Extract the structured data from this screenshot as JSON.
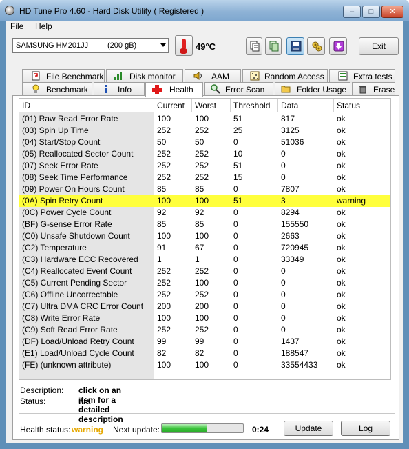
{
  "window": {
    "title": "HD Tune Pro 4.60 - Hard Disk Utility ( Registered )",
    "controls": {
      "minimize": "–",
      "maximize": "□",
      "close": "✕"
    }
  },
  "menu": {
    "file": {
      "accel": "F",
      "rest": "ile"
    },
    "help": {
      "accel": "H",
      "rest": "elp"
    }
  },
  "toolbar": {
    "drive_name": "SAMSUNG HM201JJ",
    "drive_size": "(200 gB)",
    "temperature": "49°C",
    "exit_label": "Exit",
    "icons": [
      "thermometer-icon",
      "copy-text-icon",
      "copy-screenshot-icon",
      "save-icon",
      "options-icon",
      "down-arrow-icon"
    ]
  },
  "tabs": {
    "row1": [
      "File Benchmark",
      "Disk monitor",
      "AAM",
      "Random Access",
      "Extra tests"
    ],
    "row2": [
      "Benchmark",
      "Info",
      "Health",
      "Error Scan",
      "Folder Usage",
      "Erase"
    ],
    "active": "Health"
  },
  "smart": {
    "columns": [
      "ID",
      "Current",
      "Worst",
      "Threshold",
      "Data",
      "Status"
    ],
    "rows": [
      [
        "(01) Raw Read Error Rate",
        "100",
        "100",
        "51",
        "817",
        "ok"
      ],
      [
        "(03) Spin Up Time",
        "252",
        "252",
        "25",
        "3125",
        "ok"
      ],
      [
        "(04) Start/Stop Count",
        "50",
        "50",
        "0",
        "51036",
        "ok"
      ],
      [
        "(05) Reallocated Sector Count",
        "252",
        "252",
        "10",
        "0",
        "ok"
      ],
      [
        "(07) Seek Error Rate",
        "252",
        "252",
        "51",
        "0",
        "ok"
      ],
      [
        "(08) Seek Time Performance",
        "252",
        "252",
        "15",
        "0",
        "ok"
      ],
      [
        "(09) Power On Hours Count",
        "85",
        "85",
        "0",
        "7807",
        "ok"
      ],
      [
        "(0A) Spin Retry Count",
        "100",
        "100",
        "51",
        "3",
        "warning"
      ],
      [
        "(0C) Power Cycle Count",
        "92",
        "92",
        "0",
        "8294",
        "ok"
      ],
      [
        "(BF) G-sense Error Rate",
        "85",
        "85",
        "0",
        "155550",
        "ok"
      ],
      [
        "(C0) Unsafe Shutdown Count",
        "100",
        "100",
        "0",
        "2663",
        "ok"
      ],
      [
        "(C2) Temperature",
        "91",
        "67",
        "0",
        "720945",
        "ok"
      ],
      [
        "(C3) Hardware ECC Recovered",
        "1",
        "1",
        "0",
        "33349",
        "ok"
      ],
      [
        "(C4) Reallocated Event Count",
        "252",
        "252",
        "0",
        "0",
        "ok"
      ],
      [
        "(C5) Current Pending Sector",
        "252",
        "100",
        "0",
        "0",
        "ok"
      ],
      [
        "(C6) Offline Uncorrectable",
        "252",
        "252",
        "0",
        "0",
        "ok"
      ],
      [
        "(C7) Ultra DMA CRC Error Count",
        "200",
        "200",
        "0",
        "0",
        "ok"
      ],
      [
        "(C8) Write Error Rate",
        "100",
        "100",
        "0",
        "0",
        "ok"
      ],
      [
        "(C9) Soft Read Error Rate",
        "252",
        "252",
        "0",
        "0",
        "ok"
      ],
      [
        "(DF) Load/Unload Retry Count",
        "99",
        "99",
        "0",
        "1437",
        "ok"
      ],
      [
        "(E1) Load/Unload Cycle Count",
        "82",
        "82",
        "0",
        "188547",
        "ok"
      ],
      [
        "(FE) (unknown attribute)",
        "100",
        "100",
        "0",
        "33554433",
        "ok"
      ]
    ],
    "highlight_color": "#ffff3c"
  },
  "description": {
    "label": "Description:",
    "value": "click on an item for a detailed description",
    "status_label": "Status:",
    "status_value": "n/a"
  },
  "footer": {
    "health_label": "Health status:",
    "health_value": "warning",
    "next_update_label": "Next update:",
    "progress_fraction": 0.55,
    "countdown": "0:24",
    "update_button": "Update",
    "log_button": "Log"
  },
  "colors": {
    "warning_text": "#e6a800",
    "progress_green": "#3cc43c",
    "title_gradient": "#8fb3d6"
  }
}
